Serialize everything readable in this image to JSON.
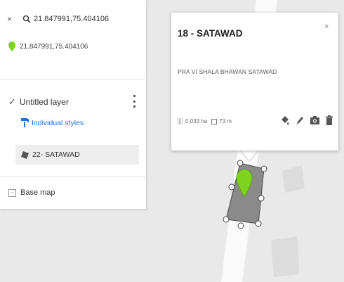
{
  "search": {
    "close_glyph": "×",
    "query": "21.847991,75.404106",
    "icon": "search-icon"
  },
  "coordinates": {
    "value": "21.847991,75.404106",
    "icon": "green-pin-icon"
  },
  "layer": {
    "title": "Untitled layer",
    "check_glyph": "✓",
    "styles_label": "Individual styles",
    "feature_label": "22- SATAWAD"
  },
  "basemap": {
    "label": "Base map"
  },
  "popup": {
    "title": "18 - SATAWAD",
    "close_glyph": "×",
    "description": "PRA VI SHALA BHAWAN SATAWAD",
    "area": "0.033 ha",
    "length": "73 m",
    "actions": [
      "paint-bucket-icon",
      "edit-pencil-icon",
      "camera-icon",
      "trash-icon"
    ]
  },
  "colors": {
    "accent_blue": "#1a73e8",
    "pin_green": "#7ed321",
    "polygon_fill": "#8a8a8a"
  }
}
